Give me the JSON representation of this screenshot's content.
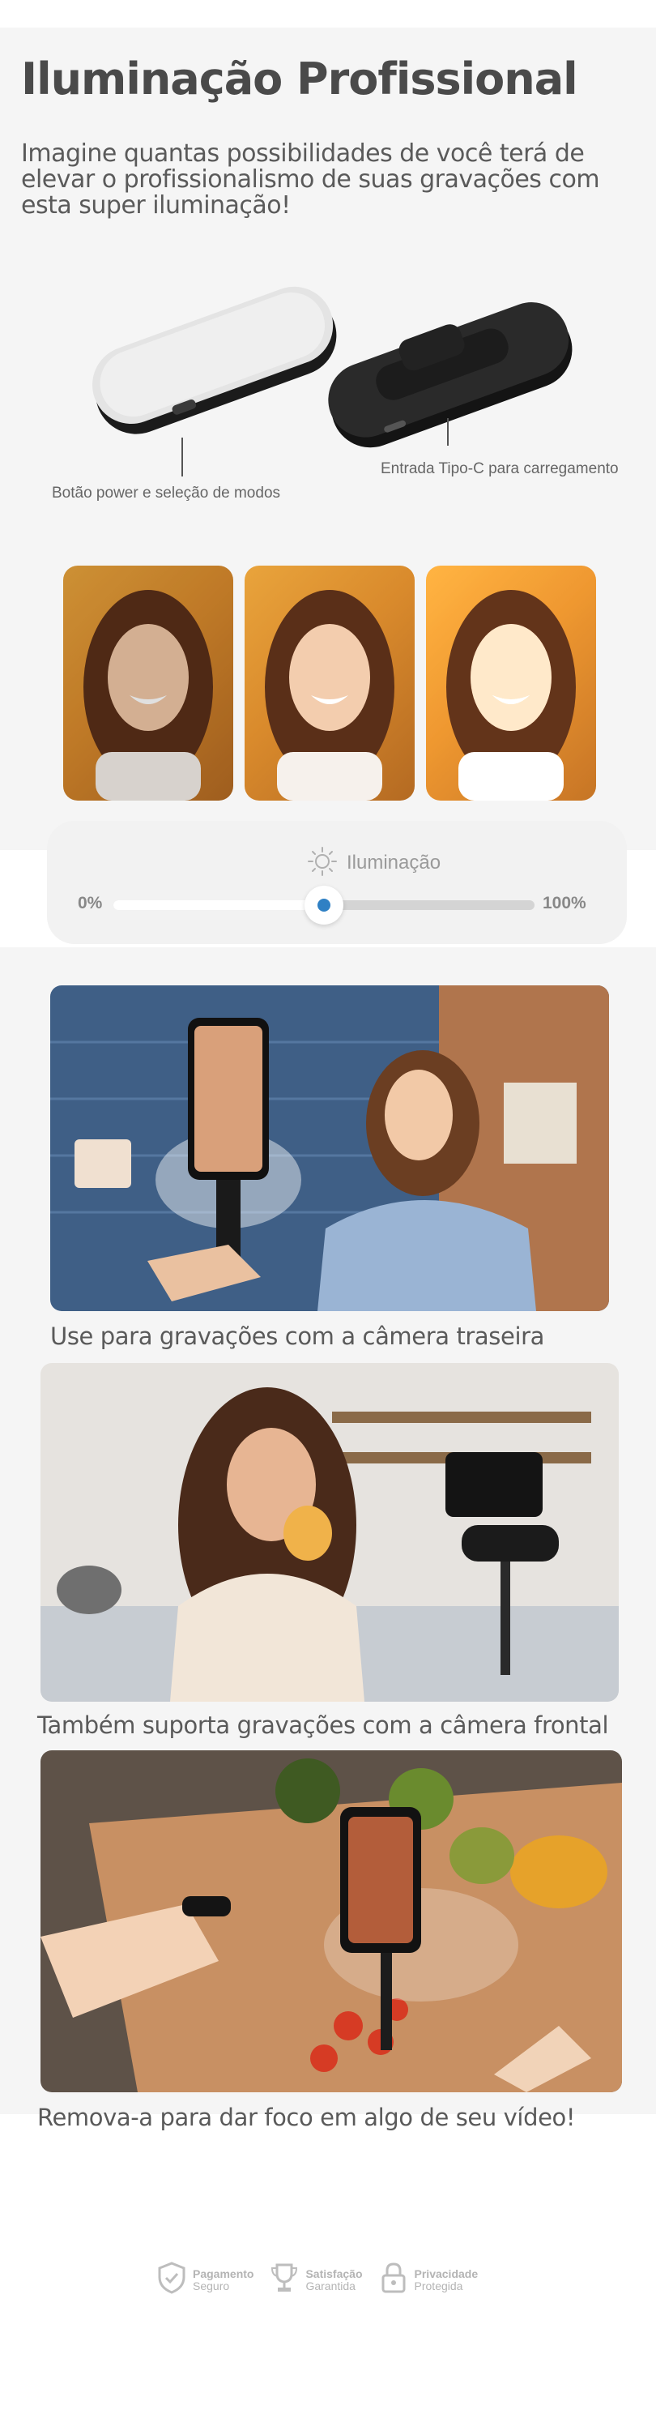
{
  "hero": {
    "title": "Iluminação Profissional",
    "subtitle": "Imagine quantas possibilidades de você terá de elevar o profissionalismo de suas gravações com esta super iluminação!"
  },
  "product": {
    "left_caption": "Botão power e seleção de modos",
    "right_caption": "Entrada Tipo-C para carregamento"
  },
  "brightness": {
    "icon": "sun-icon",
    "label": "Iluminação",
    "min_label": "0%",
    "max_label": "100%",
    "level": 0.5
  },
  "photos": [
    {
      "caption": "Use para gravações com a câmera traseira"
    },
    {
      "caption": "Também suporta gravações com a câmera frontal"
    },
    {
      "caption": "Remova-a para dar foco em algo de seu vídeo!"
    }
  ],
  "trust": [
    {
      "icon": "shield-check-icon",
      "line1": "Pagamento",
      "line2": "Seguro"
    },
    {
      "icon": "trophy-icon",
      "line1": "Satisfação",
      "line2": "Garantida"
    },
    {
      "icon": "padlock-icon",
      "line1": "Privacidade",
      "line2": "Protegida"
    }
  ],
  "colors": {
    "slider_thumb_dot": "#2f80c4",
    "headline": "#4a4a4a",
    "background": "#f5f5f5"
  }
}
